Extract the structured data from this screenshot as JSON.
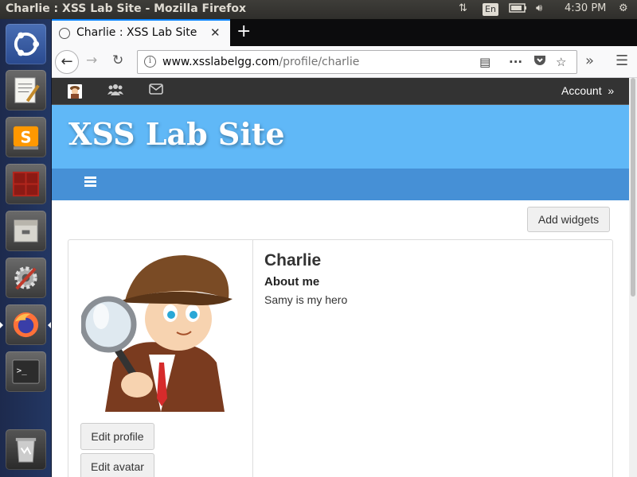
{
  "window": {
    "title": "Charlie : XSS Lab Site - Mozilla Firefox"
  },
  "system": {
    "keyboard": "En",
    "time": "4:30 PM"
  },
  "launcher": {
    "items": [
      "ubuntu-dash-icon",
      "text-editor-icon",
      "sublime-text-icon",
      "terminal-multiplexer-icon",
      "files-icon",
      "settings-icon",
      "firefox-icon",
      "terminal-icon",
      "trash-icon"
    ]
  },
  "browser": {
    "tab_title": "Charlie : XSS Lab Site",
    "url_domain": "www.xsslabelgg.com",
    "url_path": "/profile/charlie"
  },
  "site": {
    "name": "XSS Lab Site",
    "account_label": "Account",
    "account_arrow": "»",
    "add_widgets": "Add widgets"
  },
  "profile": {
    "name": "Charlie",
    "about_label": "About me",
    "about_text": "Samy is my hero",
    "edit_profile": "Edit profile",
    "edit_avatar": "Edit avatar"
  },
  "colors": {
    "header_bg": "#60b8f7",
    "menubar_bg": "#4690d6",
    "topbar_bg": "#333333",
    "tab_accent": "#0a84ff"
  }
}
